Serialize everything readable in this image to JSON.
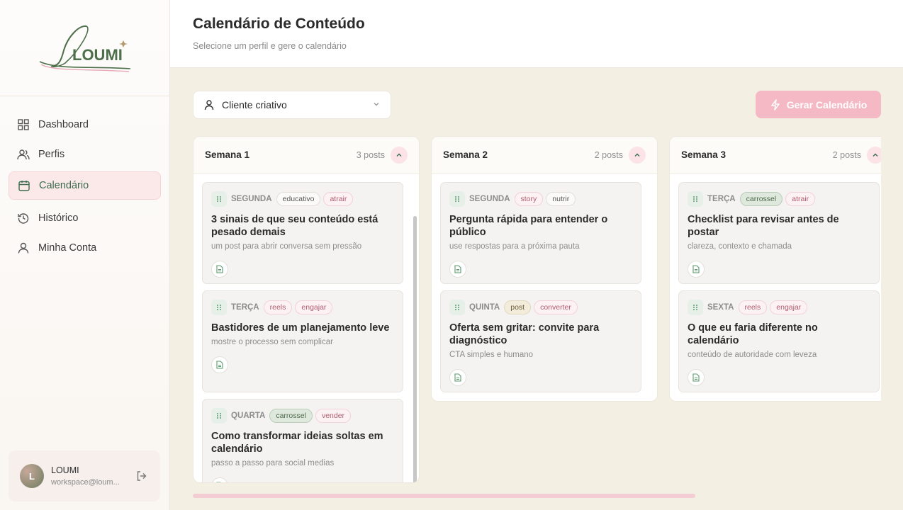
{
  "brand": {
    "logo_text": "LOUMI"
  },
  "nav": [
    {
      "label": "Dashboard",
      "icon": "grid-icon"
    },
    {
      "label": "Perfis",
      "icon": "users-icon"
    },
    {
      "label": "Calendário",
      "icon": "calendar-icon",
      "active": true
    },
    {
      "label": "Histórico",
      "icon": "history-icon"
    },
    {
      "label": "Minha Conta",
      "icon": "user-icon"
    }
  ],
  "user": {
    "initial": "L",
    "name": "LOUMI",
    "email": "workspace@loum..."
  },
  "header": {
    "title": "Calendário de Conteúdo",
    "subtitle": "Selecione um perfil e gere o calendário"
  },
  "toolbar": {
    "profile_value": "Cliente criativo",
    "generate_label": "Gerar Calendário"
  },
  "weeks": [
    {
      "title": "Semana 1",
      "count": "3 posts",
      "cards": [
        {
          "day": "SEGUNDA",
          "tags": [
            "educativo",
            "atrair"
          ],
          "title": "3 sinais de que seu conteúdo está pesado demais",
          "desc": "um post para abrir conversa sem pressão"
        },
        {
          "day": "TERÇA",
          "tags": [
            "reels",
            "engajar"
          ],
          "title": "Bastidores de um planejamento leve",
          "desc": "mostre o processo sem complicar"
        },
        {
          "day": "QUARTA",
          "tags": [
            "carrossel",
            "vender"
          ],
          "title": "Como transformar ideias soltas em calendário",
          "desc": "passo a passo para social medias"
        }
      ]
    },
    {
      "title": "Semana 2",
      "count": "2 posts",
      "cards": [
        {
          "day": "SEGUNDA",
          "tags": [
            "story",
            "nutrir"
          ],
          "title": "Pergunta rápida para entender o público",
          "desc": "use respostas para a próxima pauta"
        },
        {
          "day": "QUINTA",
          "tags": [
            "post",
            "converter"
          ],
          "title": "Oferta sem gritar: convite para diagnóstico",
          "desc": "CTA simples e humano"
        }
      ]
    },
    {
      "title": "Semana 3",
      "count": "2 posts",
      "cards": [
        {
          "day": "TERÇA",
          "tags": [
            "carrossel",
            "atrair"
          ],
          "title": "Checklist para revisar antes de postar",
          "desc": "clareza, contexto e chamada"
        },
        {
          "day": "SEXTA",
          "tags": [
            "reels",
            "engajar"
          ],
          "title": "O que eu faria diferente no calendário",
          "desc": "conteúdo de autoridade com leveza"
        }
      ]
    }
  ],
  "colors": {
    "accent_green": "#3b6a4c",
    "accent_pink": "#f4b9c4",
    "background": "#f3efe3"
  }
}
